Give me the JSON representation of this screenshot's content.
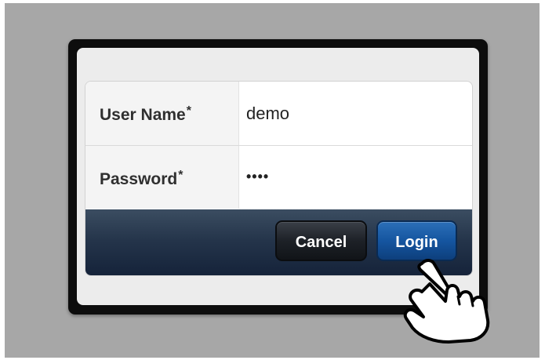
{
  "form": {
    "fields": [
      {
        "label": "User Name",
        "required_mark": "*",
        "value": "demo"
      },
      {
        "label": "Password",
        "required_mark": "*",
        "value": "••••"
      }
    ]
  },
  "actions": {
    "cancel_label": "Cancel",
    "login_label": "Login"
  },
  "colors": {
    "background": "#a7a7a7",
    "device_frame": "#0d0d0d",
    "action_bar": "#24344a",
    "login_button": "#1555a0",
    "cancel_button": "#1d2127"
  },
  "icons": {
    "pointer": "hand-pointer-icon"
  }
}
